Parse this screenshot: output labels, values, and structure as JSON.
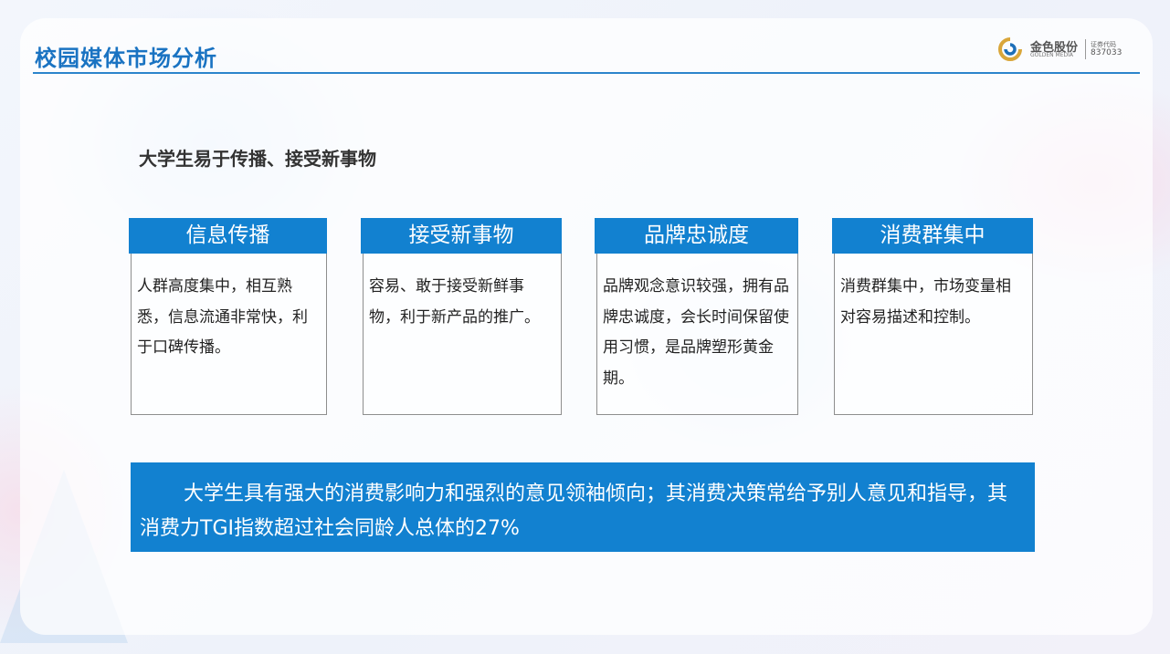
{
  "page": {
    "title": "校园媒体市场分析",
    "subtitle": "大学生易于传播、接受新事物"
  },
  "logo": {
    "name_cn": "金色股份",
    "name_en": "GOLDEN MEDIA",
    "code_label": "证券代码",
    "code": "837033"
  },
  "features": [
    {
      "heading": "信息传播",
      "body": "人群高度集中，相互熟悉，信息流通非常快，利于口碑传播。"
    },
    {
      "heading": "接受新事物",
      "body": "容易、敢于接受新鲜事物，利于新产品的推广。"
    },
    {
      "heading": "品牌忠诚度",
      "body": "品牌观念意识较强，拥有品牌忠诚度，会长时间保留使用习惯，是品牌塑形黄金期。"
    },
    {
      "heading": "消费群集中",
      "body": "消费群集中，市场变量相对容易描述和控制。"
    }
  ],
  "summary": "大学生具有强大的消费影响力和强烈的意见领袖倾向；其消费决策常给予别人意见和指导，其消费力TGI指数超过社会同龄人总体的27%",
  "colors": {
    "accent": "#1281d0",
    "title": "#1a73c2",
    "logo_gold": "#d9a63a",
    "logo_blue": "#1d6fb8"
  }
}
